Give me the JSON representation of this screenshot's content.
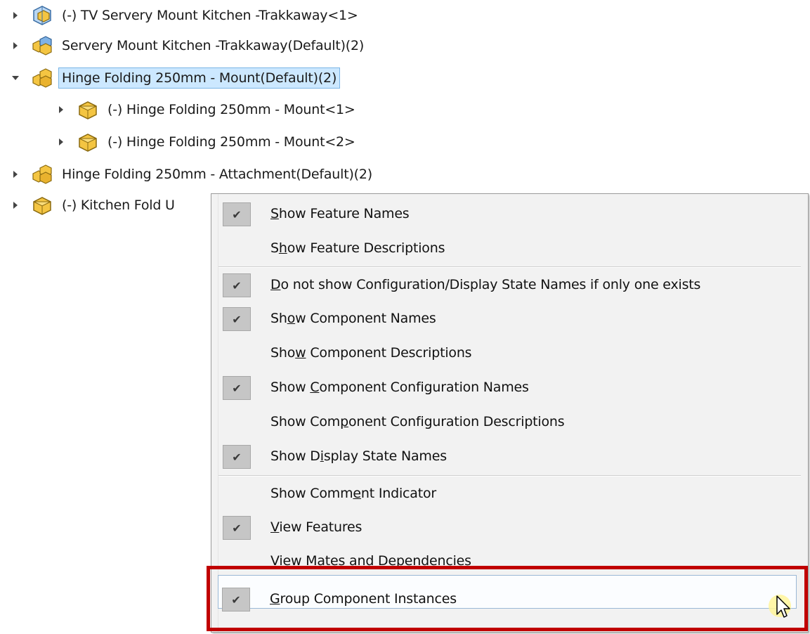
{
  "tree": {
    "items": [
      {
        "label": "(-) TV Servery Mount Kitchen -Trakkaway<1>",
        "expanded": false,
        "icon": "assembly-blue-icon"
      },
      {
        "label": "Servery Mount Kitchen -Trakkaway(Default)(2)",
        "expanded": false,
        "icon": "sub-assembly-icon"
      },
      {
        "label": "Hinge Folding 250mm - Mount(Default)(2)",
        "expanded": true,
        "selected": true,
        "icon": "part-group-icon"
      },
      {
        "label": "(-) Hinge Folding 250mm - Mount<1>",
        "expanded": false,
        "icon": "part-yellow-icon"
      },
      {
        "label": "(-) Hinge Folding 250mm - Mount<2>",
        "expanded": false,
        "icon": "part-yellow-icon"
      },
      {
        "label": "Hinge Folding 250mm - Attachment(Default)(2)",
        "expanded": false,
        "icon": "part-group-icon"
      },
      {
        "label": "(-) Kitchen Fold U",
        "expanded": false,
        "icon": "part-yellow-icon"
      }
    ]
  },
  "menu": {
    "items": [
      {
        "pre": "",
        "key": "S",
        "post": "how Feature Names",
        "checked": true
      },
      {
        "pre": "S",
        "key": "h",
        "post": "ow Feature Descriptions",
        "checked": false
      },
      {
        "pre": "",
        "key": "D",
        "post": "o not show Configuration/Display State Names if only one exists",
        "checked": true
      },
      {
        "pre": "Sh",
        "key": "o",
        "post": "w Component Names",
        "checked": true
      },
      {
        "pre": "Sho",
        "key": "w",
        "post": " Component Descriptions",
        "checked": false
      },
      {
        "pre": "Show ",
        "key": "C",
        "post": "omponent Configuration Names",
        "checked": true
      },
      {
        "pre": "Show Com",
        "key": "p",
        "post": "onent Configuration Descriptions",
        "checked": false
      },
      {
        "pre": "Show D",
        "key": "i",
        "post": "splay State Names",
        "checked": true
      },
      {
        "pre": "Show Comm",
        "key": "e",
        "post": "nt Indicator",
        "checked": false
      },
      {
        "pre": "",
        "key": "V",
        "post": "iew Features",
        "checked": true
      },
      {
        "pre": "View Mates and Dependencies",
        "key": "",
        "post": "",
        "checked": false
      },
      {
        "pre": "",
        "key": "G",
        "post": "roup Component Instances",
        "checked": true
      }
    ],
    "check_glyph": "✔",
    "highlight_color": "#c00000"
  }
}
